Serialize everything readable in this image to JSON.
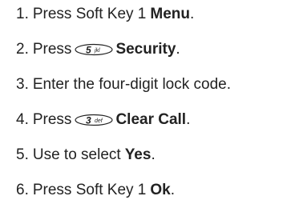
{
  "steps": [
    {
      "num": "1.",
      "pre": "Press Soft Key 1",
      "bold": "Menu",
      "post": "."
    },
    {
      "num": "2.",
      "pre": "Press",
      "key": {
        "digit": "5",
        "letters": "jkl",
        "icon": "key-5-jkl-icon"
      },
      "bold": "Security",
      "post": "."
    },
    {
      "num": "3.",
      "pre": "Enter the four-digit lock code."
    },
    {
      "num": "4.",
      "pre": "Press",
      "key": {
        "digit": "3",
        "letters": "def",
        "icon": "key-3-def-icon"
      },
      "bold": "Clear Call",
      "post": "."
    },
    {
      "num": "5.",
      "pre": "Use to select",
      "bold": "Yes",
      "post": "."
    },
    {
      "num": "6.",
      "pre": "Press Soft Key 1",
      "bold": "Ok",
      "post": "."
    }
  ]
}
